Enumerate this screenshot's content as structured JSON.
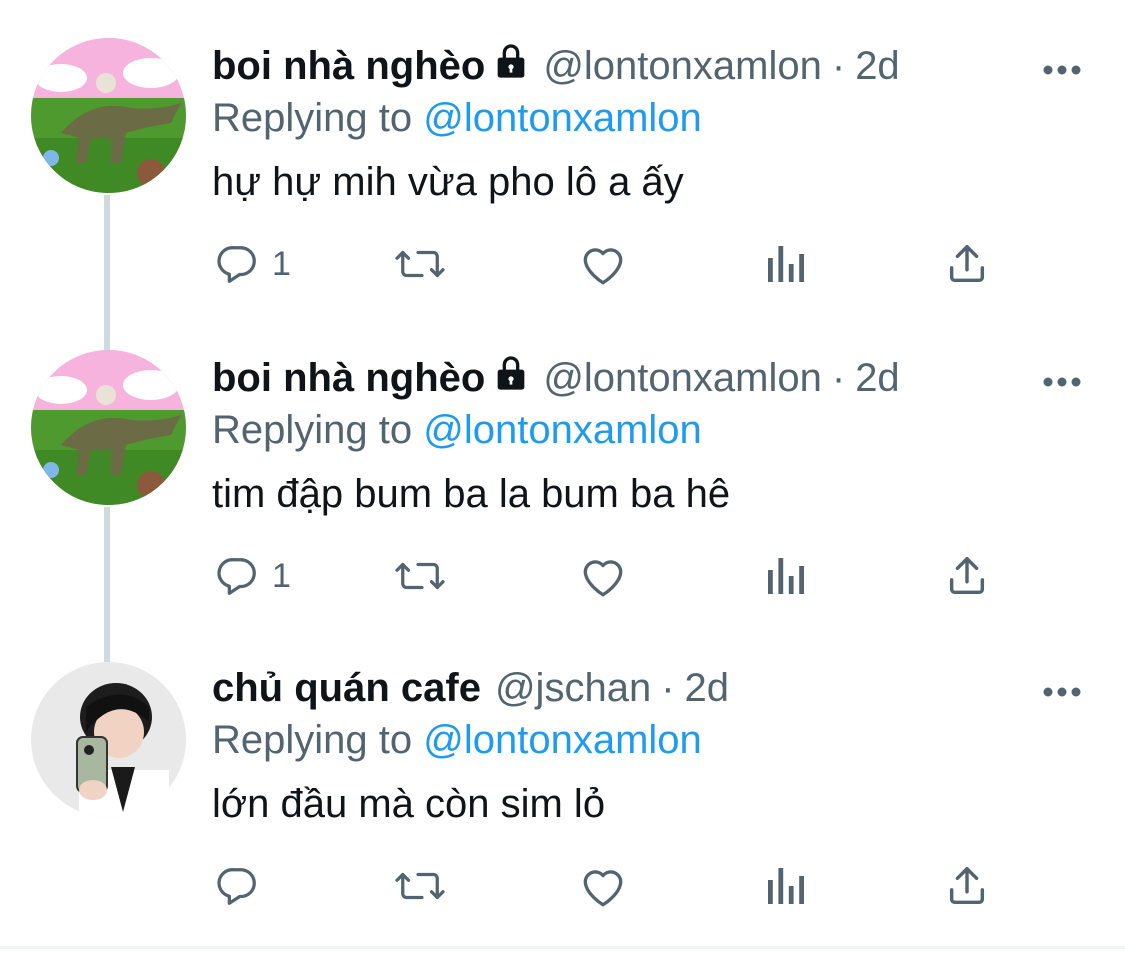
{
  "tweets": [
    {
      "display_name": "boi nhà nghèo",
      "locked": true,
      "handle": "@lontonxamlon",
      "separator": "·",
      "time": "2d",
      "replying_prefix": "Replying to",
      "replying_to": "@lontonxamlon",
      "text": "hự hự mih vừa pho lô a ấy",
      "reply_count": "1"
    },
    {
      "display_name": "boi nhà nghèo",
      "locked": true,
      "handle": "@lontonxamlon",
      "separator": "·",
      "time": "2d",
      "replying_prefix": "Replying to",
      "replying_to": "@lontonxamlon",
      "text": "tim đập bum ba la bum ba hê",
      "reply_count": "1"
    },
    {
      "display_name": "chủ quán cafe",
      "locked": false,
      "handle": "@jschan",
      "separator": "·",
      "time": "2d",
      "replying_prefix": "Replying to",
      "replying_to": "@lontonxamlon",
      "text": "lớn đầu mà còn sim lỏ",
      "reply_count": ""
    }
  ],
  "icons": {
    "reply": "reply-icon",
    "retweet": "retweet-icon",
    "like": "heart-icon",
    "views": "views-icon",
    "share": "share-icon",
    "more": "more-icon",
    "lock": "lock-icon"
  },
  "colors": {
    "text": "#0f1419",
    "secondary": "#536471",
    "link": "#1d9bf0",
    "thread_line": "#cfd9de"
  }
}
